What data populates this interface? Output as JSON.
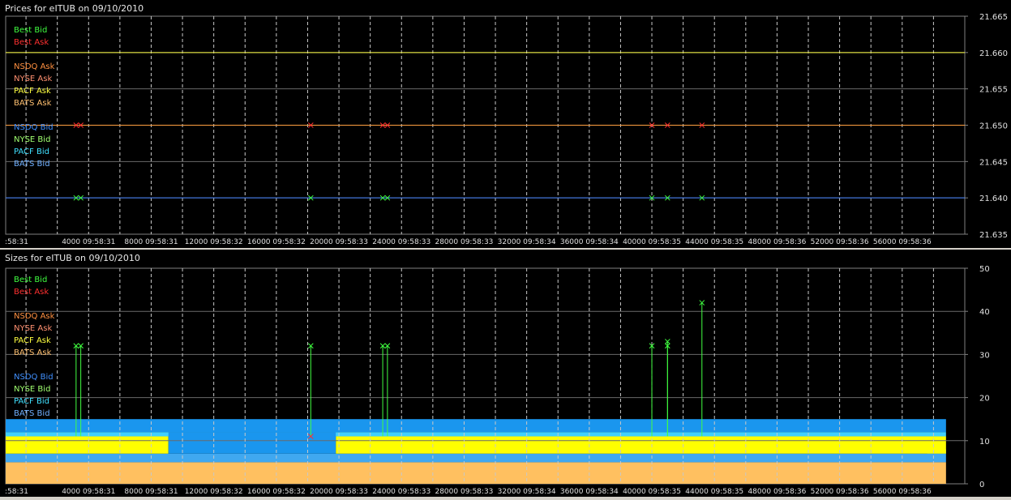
{
  "price_panel": {
    "title": "Prices for  eITUB  on  09/10/2010",
    "y_ticks": [
      "21.665",
      "21.660",
      "21.655",
      "21.650",
      "21.645",
      "21.640",
      "21.635"
    ],
    "x_ticks": [
      ":58:31",
      "4000 09:58:31",
      "8000 09:58:31",
      "12000 09:58:32",
      "16000 09:58:32",
      "20000 09:58:33",
      "24000 09:58:33",
      "28000 09:58:33",
      "32000 09:58:34",
      "36000 09:58:34",
      "40000 09:58:35",
      "44000 09:58:35",
      "48000 09:58:36",
      "52000 09:58:36",
      "56000 09:58:36"
    ]
  },
  "size_panel": {
    "title": "Sizes for  eITUB  on  09/10/2010",
    "y_ticks": [
      "50",
      "40",
      "30",
      "20",
      "10",
      "0"
    ],
    "x_ticks": [
      ":58:31",
      "4000 09:58:31",
      "8000 09:58:31",
      "12000 09:58:32",
      "16000 09:58:32",
      "20000 09:58:33",
      "24000 09:58:33",
      "28000 09:58:33",
      "32000 09:58:34",
      "36000 09:58:34",
      "40000 09:58:35",
      "44000 09:58:35",
      "48000 09:58:36",
      "52000 09:58:36",
      "56000 09:58:36"
    ]
  },
  "legend": [
    {
      "label": "Best Bid",
      "color": "#40ff40"
    },
    {
      "label": "Best Ask",
      "color": "#ff3030"
    },
    {
      "label": "",
      "color": ""
    },
    {
      "label": "NSDQ Ask",
      "color": "#ff9040"
    },
    {
      "label": "NYSE Ask",
      "color": "#ff9070"
    },
    {
      "label": "PACF Ask",
      "color": "#ffff40"
    },
    {
      "label": "BATS Ask",
      "color": "#ffc070"
    },
    {
      "label": "",
      "color": ""
    },
    {
      "label": "NSDQ Bid",
      "color": "#4090ff"
    },
    {
      "label": "NYSE Bid",
      "color": "#a0ff70"
    },
    {
      "label": "PACF Bid",
      "color": "#40e0ff"
    },
    {
      "label": "BATS Bid",
      "color": "#70b0ff"
    }
  ],
  "chart_data": [
    {
      "type": "scatter",
      "title": "Prices for  eITUB  on  09/10/2010",
      "ylim": [
        21.635,
        21.665
      ],
      "xlim": [
        -1300,
        60000
      ],
      "reference_lines": [
        {
          "name": "PACF Ask",
          "y": 21.66,
          "color": "#ffff40"
        },
        {
          "name": "NSDQ Ask",
          "y": 21.65,
          "color": "#ffa040"
        },
        {
          "name": "NSDQ Bid",
          "y": 21.64,
          "color": "#4080ff"
        }
      ],
      "series": [
        {
          "name": "Best Ask",
          "color": "#ff3030",
          "points": [
            [
              3200,
              21.65
            ],
            [
              3500,
              21.65
            ],
            [
              18200,
              21.65
            ],
            [
              22800,
              21.65
            ],
            [
              23100,
              21.65
            ],
            [
              40000,
              21.65
            ],
            [
              41000,
              21.65
            ],
            [
              43200,
              21.65
            ]
          ]
        },
        {
          "name": "Best Bid",
          "color": "#40ff40",
          "points": [
            [
              3200,
              21.64
            ],
            [
              3500,
              21.64
            ],
            [
              18200,
              21.64
            ],
            [
              22800,
              21.64
            ],
            [
              23100,
              21.64
            ],
            [
              40000,
              21.64
            ],
            [
              41000,
              21.64
            ],
            [
              43200,
              21.64
            ]
          ]
        }
      ]
    },
    {
      "type": "area",
      "title": "Sizes for  eITUB  on  09/10/2010",
      "ylim": [
        0,
        50
      ],
      "xlim": [
        -1300,
        60000
      ],
      "bands": [
        {
          "name": "BATS Ask",
          "color": "#ffc060",
          "segments": [
            [
              -1300,
              58800,
              0,
              5
            ]
          ]
        },
        {
          "name": "BATS Bid",
          "color": "#40a8f0",
          "segments": [
            [
              -1300,
              58800,
              5,
              7
            ],
            [
              57600,
              58800,
              7,
              8
            ]
          ]
        },
        {
          "name": "PACF Ask",
          "color": "#ffff00",
          "segments": [
            [
              -1300,
              9100,
              7,
              11
            ],
            [
              19800,
              58800,
              7,
              11
            ]
          ]
        },
        {
          "name": "PACF Bid",
          "color": "#40d0ff",
          "segments": [
            [
              -1300,
              58800,
              11,
              12
            ]
          ]
        },
        {
          "name": "NSDQ Bid",
          "color": "#1a96ee",
          "segments": [
            [
              -1300,
              58800,
              12,
              15
            ],
            [
              9100,
              19800,
              7,
              12
            ]
          ]
        }
      ],
      "series": [
        {
          "name": "Best Bid",
          "color": "#40ff40",
          "points": [
            [
              3200,
              32
            ],
            [
              3500,
              32
            ],
            [
              18200,
              32
            ],
            [
              22800,
              32
            ],
            [
              23100,
              32
            ],
            [
              40000,
              32
            ],
            [
              41000,
              32
            ],
            [
              41000,
              33
            ],
            [
              43200,
              42
            ]
          ]
        },
        {
          "name": "Best Ask",
          "color": "#ff3030",
          "points": [
            [
              18200,
              11
            ]
          ]
        }
      ]
    }
  ]
}
